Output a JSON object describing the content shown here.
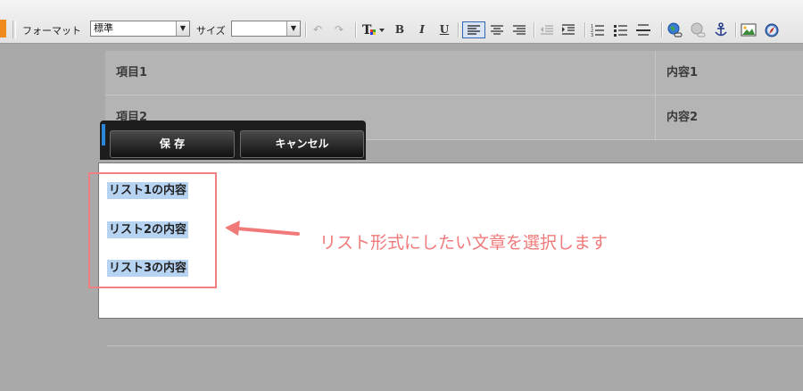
{
  "toolbar": {
    "format_label": "フォーマット",
    "format_value": "標準",
    "size_label": "サイズ",
    "size_value": "",
    "bold": "B",
    "italic": "I",
    "underline": "U",
    "undo_glyph": "↶",
    "redo_glyph": "↷",
    "dropdown_arrow": "▼"
  },
  "table": {
    "rows": [
      {
        "item": "項目1",
        "content": "内容1"
      },
      {
        "item": "項目2",
        "content": "内容2"
      }
    ]
  },
  "buttons": {
    "save": "保 存",
    "cancel": "キャンセル"
  },
  "editor": {
    "lines": [
      "リスト1の内容",
      "リスト2の内容",
      "リスト3の内容"
    ]
  },
  "annotation": {
    "text": "リスト形式にしたい文章を選択します",
    "color": "#f07a7a"
  }
}
